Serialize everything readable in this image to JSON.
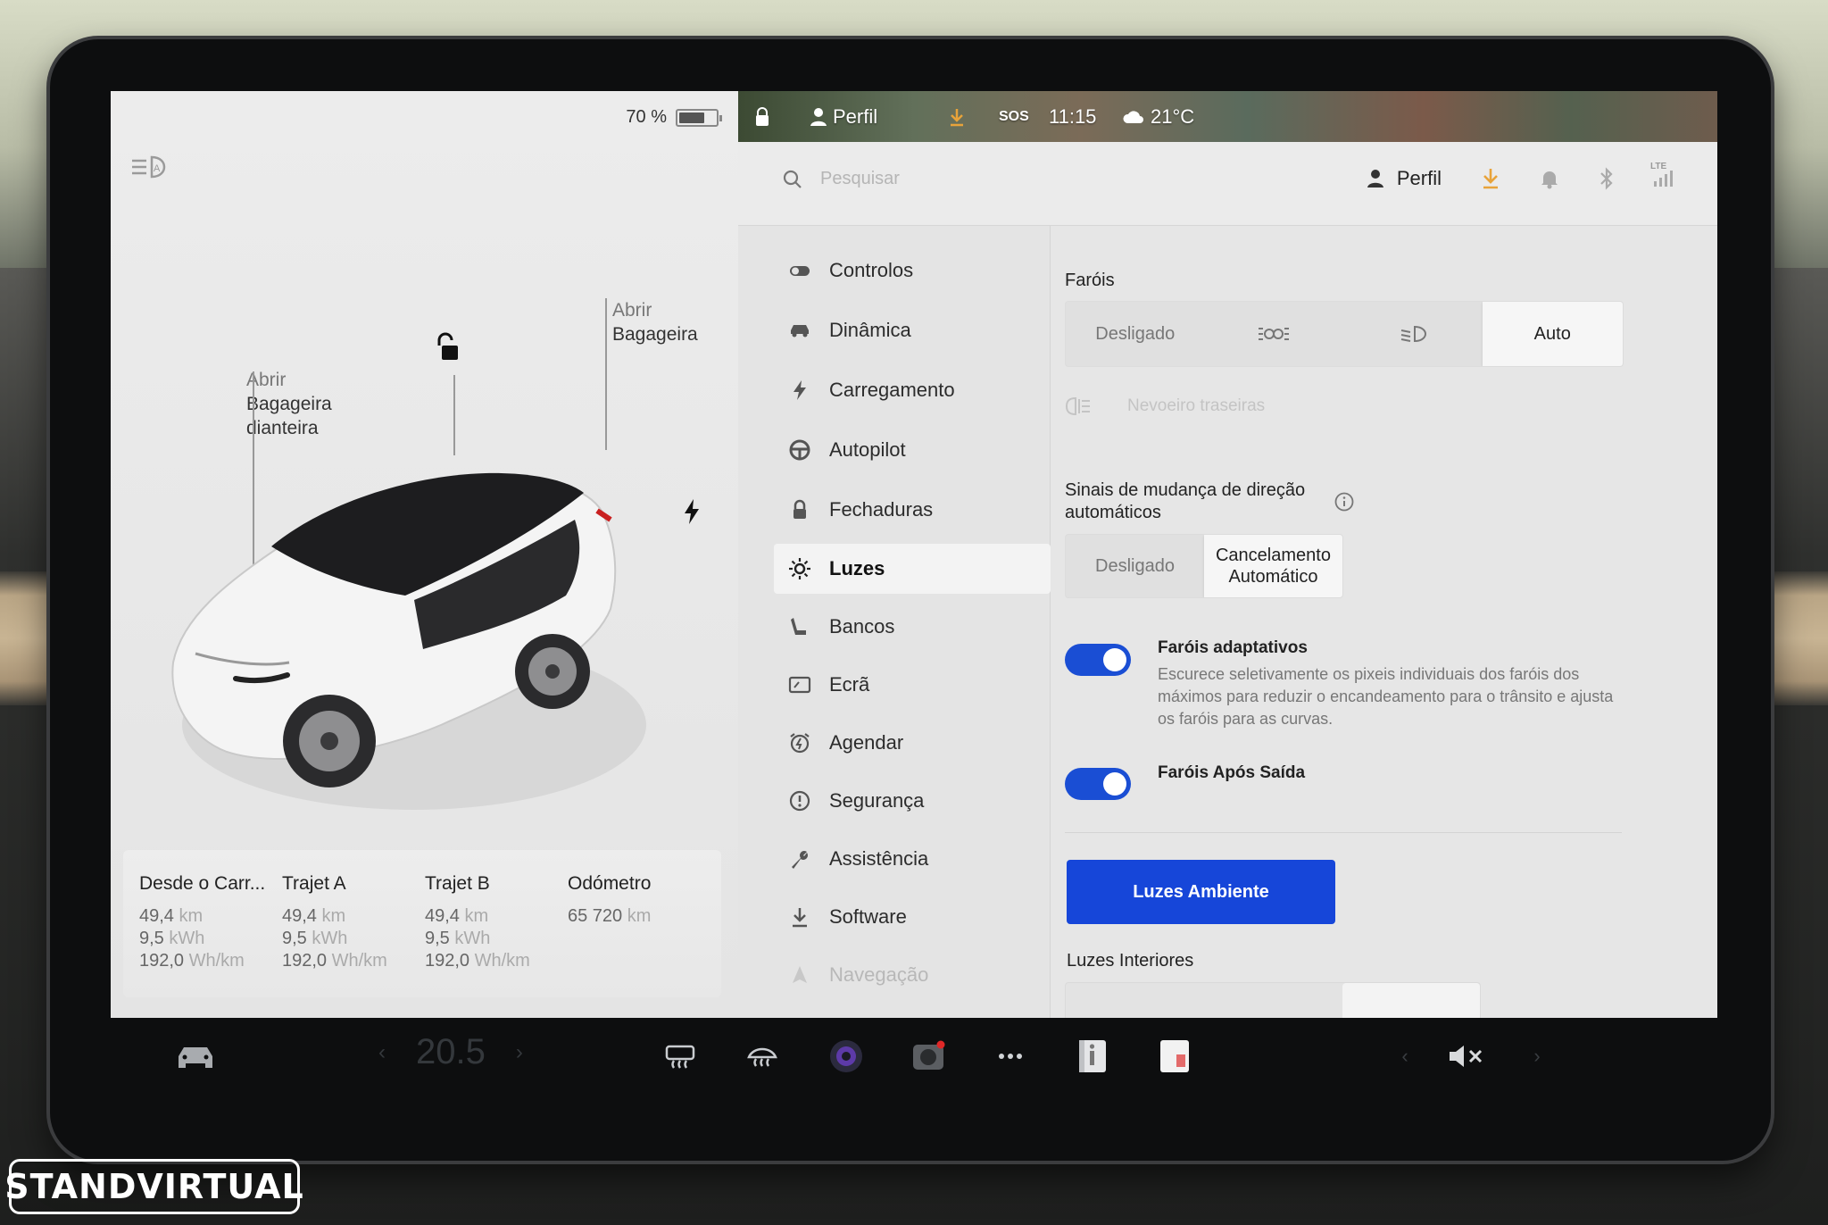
{
  "status_bar": {
    "battery_percent": "70 %",
    "battery_level": 0.7,
    "map_profile": "Perfil",
    "sos": "SOS",
    "time": "11:15",
    "weather_temp": "21°C"
  },
  "vehicle_panel": {
    "callout_front_trunk": {
      "line1": "Abrir",
      "line2": "Bagageira",
      "line3": "dianteira"
    },
    "callout_rear_trunk": {
      "line1": "Abrir",
      "line2": "Bagageira"
    }
  },
  "trip_stats": [
    {
      "title": "Desde o Carr...",
      "distance": "49,4",
      "distance_unit": "km",
      "energy": "9,5",
      "energy_unit": "kWh",
      "efficiency": "192,0",
      "efficiency_unit": "Wh/km"
    },
    {
      "title": "Trajet A",
      "distance": "49,4",
      "distance_unit": "km",
      "energy": "9,5",
      "energy_unit": "kWh",
      "efficiency": "192,0",
      "efficiency_unit": "Wh/km"
    },
    {
      "title": "Trajet B",
      "distance": "49,4",
      "distance_unit": "km",
      "energy": "9,5",
      "energy_unit": "kWh",
      "efficiency": "192,0",
      "efficiency_unit": "Wh/km"
    },
    {
      "title": "Odómetro",
      "distance": "65 720",
      "distance_unit": "km"
    }
  ],
  "top_bar": {
    "search_placeholder": "Pesquisar",
    "profile_label": "Perfil",
    "lte_label": "LTE",
    "accent_color": "#e8a33a"
  },
  "menu": {
    "items": [
      {
        "label": "Controlos",
        "icon": "toggle-icon"
      },
      {
        "label": "Dinâmica",
        "icon": "car-icon"
      },
      {
        "label": "Carregamento",
        "icon": "bolt-icon"
      },
      {
        "label": "Autopilot",
        "icon": "steering-wheel-icon"
      },
      {
        "label": "Fechaduras",
        "icon": "lock-icon"
      },
      {
        "label": "Luzes",
        "icon": "sun-icon",
        "active": true
      },
      {
        "label": "Bancos",
        "icon": "seat-icon"
      },
      {
        "label": "Ecrã",
        "icon": "screen-icon"
      },
      {
        "label": "Agendar",
        "icon": "alarm-clock-icon"
      },
      {
        "label": "Segurança",
        "icon": "alert-circle-icon"
      },
      {
        "label": "Assistência",
        "icon": "wrench-icon"
      },
      {
        "label": "Software",
        "icon": "download-icon"
      },
      {
        "label": "Navegação",
        "icon": "navigation-icon"
      }
    ]
  },
  "lights": {
    "headlights_title": "Faróis",
    "headlights_options": {
      "off": "Desligado",
      "parking_icon": "parking-lights-icon",
      "lowbeam_icon": "low-beam-icon",
      "auto": "Auto",
      "selected": "Auto"
    },
    "rear_fog_label": "Nevoeiro traseiras",
    "turn_signals_title": "Sinais de mudança de direção automáticos",
    "turn_signals_options": {
      "off": "Desligado",
      "auto": "Cancelamento Automático",
      "selected": "Cancelamento Automático"
    },
    "adaptive_title": "Faróis adaptativos",
    "adaptive_desc": "Escurece seletivamente os pixeis individuais dos faróis dos máximos para reduzir o encandeamento para o trânsito e ajusta os faróis para as curvas.",
    "adaptive_on": true,
    "after_exit_title": "Faróis Após Saída",
    "after_exit_on": true,
    "ambient_button": "Luzes Ambiente",
    "ambient_color": "#1646d9",
    "interior_title": "Luzes Interiores"
  },
  "taskbar": {
    "temperature": "20.5",
    "icons": [
      "car-icon",
      "rear-defrost-icon",
      "front-defrost-icon",
      "camera-app-icon",
      "dashcam-icon",
      "more-icon",
      "manual-icon",
      "calendar-icon",
      "volume-mute-icon"
    ]
  },
  "watermark": "STANDVIRTUAL"
}
